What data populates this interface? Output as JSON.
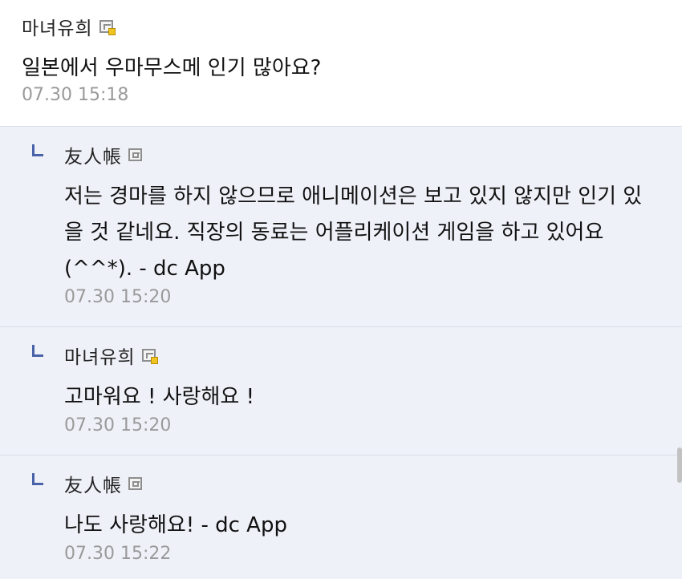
{
  "comments": [
    {
      "author": "마녀유희",
      "badge_icon": "gallery-user-gold-icon",
      "text": "일본에서 우마무스메 인기 많아요?",
      "time": "07.30 15:18"
    },
    {
      "author": "友人帳",
      "badge_icon": "gallery-user-silver-icon",
      "text": "저는 경마를 하지 않으므로 애니메이션은 보고 있지 않지만 인기 있을 것 같네요. 직장의 동료는 어플리케이션 게임을 하고 있어요(^^*). - dc App",
      "time": "07.30 15:20"
    },
    {
      "author": "마녀유희",
      "badge_icon": "gallery-user-gold-icon",
      "text": "고마워요 ! 사랑해요 !",
      "time": "07.30 15:20"
    },
    {
      "author": "友人帳",
      "badge_icon": "gallery-user-silver-icon",
      "text": "나도 사랑해요! - dc App",
      "time": "07.30 15:22"
    }
  ],
  "colors": {
    "reply_background": "#eef1f8",
    "reply_marker": "#4a62a8",
    "timestamp": "#9a9a9a"
  }
}
